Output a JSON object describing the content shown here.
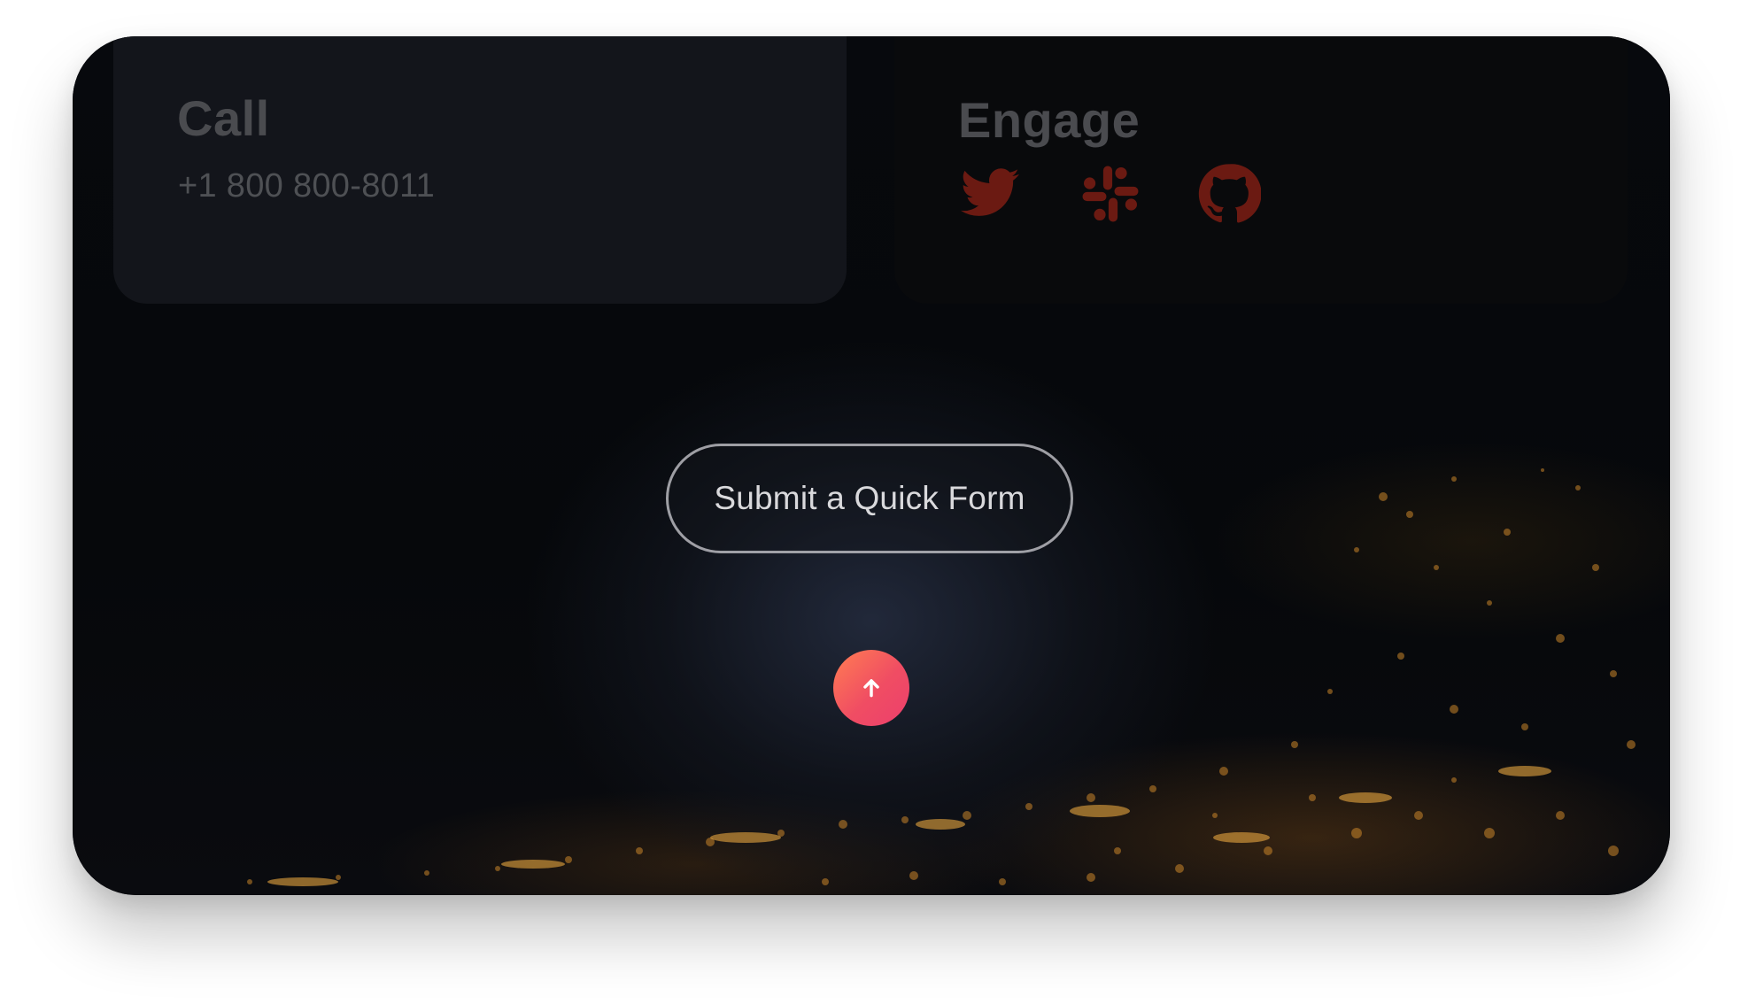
{
  "contact": {
    "call": {
      "title": "Call",
      "phone": "+1 800 800-8011"
    },
    "engage": {
      "title": "Engage",
      "icons": [
        "twitter-icon",
        "slack-icon",
        "github-icon"
      ],
      "icon_color": "#6b1a12"
    }
  },
  "cta": {
    "quick_form_label": "Submit a Quick Form",
    "scroll_top_icon": "arrow-up-icon",
    "accent_gradient": [
      "#ff7e52",
      "#ec3f6d"
    ]
  }
}
